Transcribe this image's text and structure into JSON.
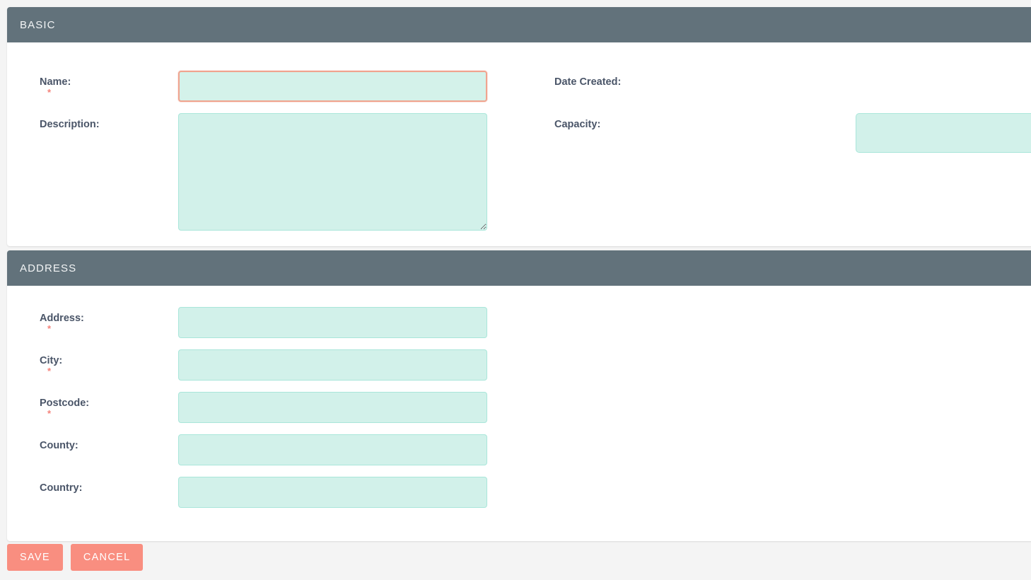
{
  "theme": {
    "page_background": "#f4f4f4",
    "panel_background": "#ffffff",
    "panel_header_background": "#62727b",
    "panel_header_text": "#f2f4f5",
    "input_background": "#d2f1ea",
    "input_border": "#a9e6da",
    "input_focus_border": "#f0a48f",
    "required_marker_color": "#f4827a",
    "label_color": "#4a5568",
    "button_background": "#f98e80",
    "button_text": "#ffffff"
  },
  "sections": [
    {
      "id": "basic",
      "title": "BASIC",
      "fields": [
        {
          "id": "name",
          "label": "Name:",
          "required": true,
          "required_marker": "*",
          "control": "text",
          "value": "",
          "placeholder": "",
          "focused": true
        },
        {
          "id": "date-created",
          "label": "Date Created:",
          "required": false,
          "required_marker": "",
          "control": "readonly-text",
          "value": "",
          "placeholder": "",
          "focused": false
        },
        {
          "id": "description",
          "label": "Description:",
          "required": false,
          "required_marker": "",
          "control": "textarea",
          "value": "",
          "placeholder": "",
          "focused": false
        },
        {
          "id": "capacity",
          "label": "Capacity:",
          "required": false,
          "required_marker": "",
          "control": "text",
          "value": "",
          "placeholder": "",
          "focused": false
        }
      ]
    },
    {
      "id": "address",
      "title": "ADDRESS",
      "fields": [
        {
          "id": "address",
          "label": "Address:",
          "required": true,
          "required_marker": "*",
          "control": "text",
          "value": "",
          "placeholder": "",
          "focused": false
        },
        {
          "id": "city",
          "label": "City:",
          "required": true,
          "required_marker": "*",
          "control": "text",
          "value": "",
          "placeholder": "",
          "focused": false
        },
        {
          "id": "postcode",
          "label": "Postcode:",
          "required": true,
          "required_marker": "*",
          "control": "text",
          "value": "",
          "placeholder": "",
          "focused": false
        },
        {
          "id": "county",
          "label": "County:",
          "required": false,
          "required_marker": "",
          "control": "text",
          "value": "",
          "placeholder": "",
          "focused": false
        },
        {
          "id": "country",
          "label": "Country:",
          "required": false,
          "required_marker": "",
          "control": "text",
          "value": "",
          "placeholder": "",
          "focused": false
        }
      ]
    }
  ],
  "footer": {
    "save_label": "SAVE",
    "cancel_label": "CANCEL"
  }
}
